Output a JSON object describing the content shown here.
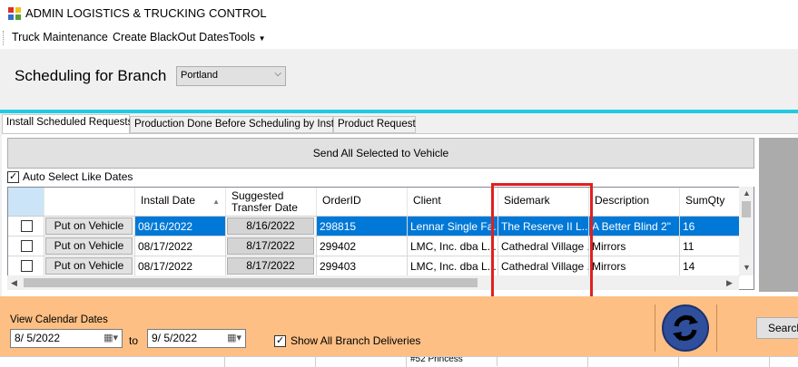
{
  "window": {
    "title": "ADMIN LOGISTICS & TRUCKING CONTROL"
  },
  "menu": {
    "items": [
      "Truck Maintenance",
      "Create BlackOut Dates",
      "Tools"
    ]
  },
  "branch": {
    "label": "Scheduling for Branch",
    "selected": "Portland"
  },
  "tabs": [
    "Install Scheduled Requests",
    "Production Done Before Scheduling by Install",
    "Product Request"
  ],
  "send_button": "Send All Selected to Vehicle",
  "auto_select": {
    "label": "Auto Select Like Dates",
    "checked": true
  },
  "grid": {
    "columns": [
      "Install Date",
      "Suggested Transfer Date",
      "OrderID",
      "Client",
      "Sidemark",
      "Description",
      "SumQty"
    ],
    "suggested_line1": "Suggested",
    "suggested_line2": "Transfer Date",
    "put_label": "Put on Vehicle",
    "rows": [
      {
        "install": "08/16/2022",
        "transfer": "8/16/2022",
        "order": "298815",
        "client": "Lennar Single Fa...",
        "sidemark": "The Reserve II L...",
        "desc": "A Better Blind 2\"",
        "qty": "16",
        "selected": true
      },
      {
        "install": "08/17/2022",
        "transfer": "8/17/2022",
        "order": "299402",
        "client": "LMC, Inc. dba L...",
        "sidemark": "Cathedral Village ...",
        "desc": "Mirrors",
        "qty": "11",
        "selected": false
      },
      {
        "install": "08/17/2022",
        "transfer": "8/17/2022",
        "order": "299403",
        "client": "LMC, Inc. dba L...",
        "sidemark": "Cathedral Village ...",
        "desc": "Mirrors",
        "qty": "14",
        "selected": false
      }
    ]
  },
  "calendar": {
    "label": "View Calendar Dates",
    "from": "8/ 5/2022",
    "to_label": "to",
    "to": "9/ 5/2022",
    "show_all_label": "Show All Branch Deliveries",
    "show_all_checked": true
  },
  "search_label": "Search",
  "bottom_strip": [
    "#52 Princess"
  ],
  "colors": {
    "accent_cyan": "#1ecbe1",
    "selection_blue": "#0078d7",
    "orange_panel": "#fdbf84",
    "highlight_red": "#e0201f"
  }
}
